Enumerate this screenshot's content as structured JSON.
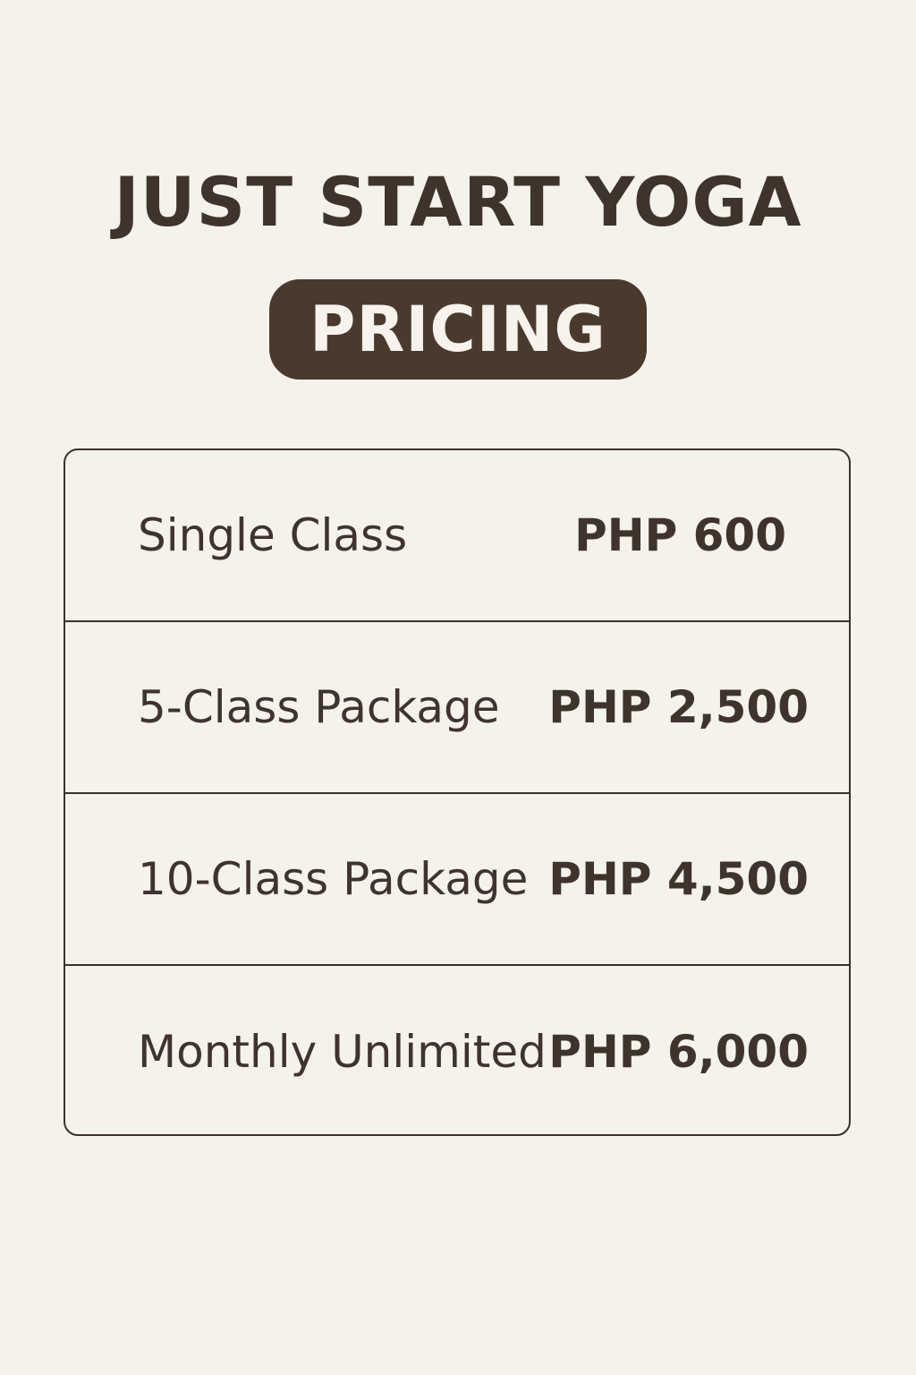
{
  "brand": {
    "title": "JUST START YOGA",
    "badge": "PRICING"
  },
  "pricing": {
    "items": [
      {
        "label": "Single Class",
        "price": "PHP 600"
      },
      {
        "label": "5-Class Package",
        "price": "PHP 2,500"
      },
      {
        "label": "10-Class Package",
        "price": "PHP 4,500"
      },
      {
        "label": "Monthly Unlimited",
        "price": "PHP 6,000"
      }
    ]
  },
  "colors": {
    "background": "#f5f2ec",
    "text": "#3f342c",
    "badge_background": "#4a3a2e",
    "badge_text": "#f7f3ec",
    "table_border": "#3b3029"
  }
}
